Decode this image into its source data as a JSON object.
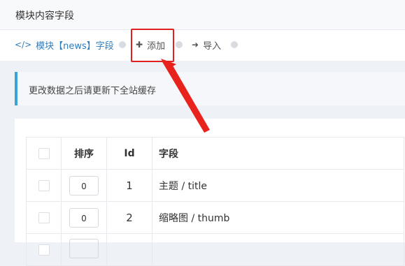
{
  "window": {
    "title": "模块内容字段"
  },
  "nav": {
    "current": {
      "icon": "code-icon",
      "glyph": "</>",
      "label": "模块【news】字段"
    },
    "add": {
      "icon": "plus-icon",
      "glyph": "✚",
      "label": "添加"
    },
    "import": {
      "icon": "sign-in-icon",
      "glyph": "➜",
      "label": "导入"
    }
  },
  "notice": {
    "text": "更改数据之后请更新下全站缓存"
  },
  "table": {
    "headers": {
      "sort": "排序",
      "id": "Id",
      "field": "字段"
    },
    "rows": [
      {
        "sort": "0",
        "id": "1",
        "field": "主题 / title"
      },
      {
        "sort": "0",
        "id": "2",
        "field": "缩略图 / thumb"
      },
      {
        "sort": "",
        "id": "",
        "field": ""
      }
    ]
  },
  "colors": {
    "accent": "#2f7cbd",
    "notice_border": "#3aa4d6",
    "highlight": "#e02020"
  }
}
